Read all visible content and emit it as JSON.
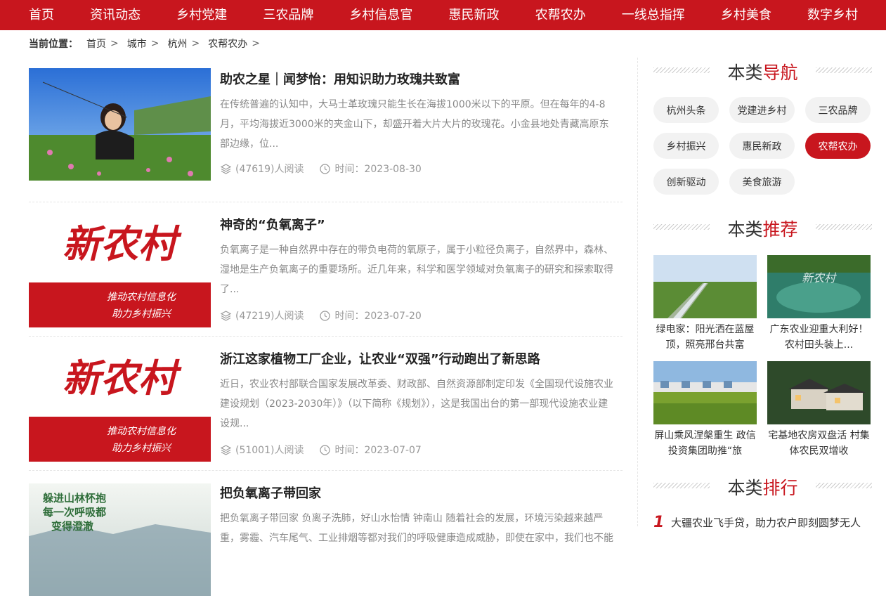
{
  "nav": [
    "首页",
    "资讯动态",
    "乡村党建",
    "三农品牌",
    "乡村信息官",
    "惠民新政",
    "农帮农办",
    "一线总指挥",
    "乡村美食",
    "数字乡村"
  ],
  "breadcrumb": {
    "label": "当前位置：",
    "items": [
      "首页",
      "城市",
      "杭州",
      "农帮农办"
    ],
    "separator": ">"
  },
  "articles": [
    {
      "title": "助农之星｜闻梦怡：用知识助力玫瑰共致富",
      "desc": "在传统普遍的认知中，大马士革玫瑰只能生长在海拔1000米以下的平原。但在每年的4-8月，平均海拔近3000米的夹金山下，却盛开着大片大片的玫瑰花。小金县地处青藏高原东部边缘，位...",
      "views": "(47619)人阅读",
      "time": "时间：2023-08-30",
      "image": "photo"
    },
    {
      "title": "神奇的“负氧离子”",
      "desc": "负氧离子是一种自然界中存在的带负电荷的氧原子，属于小粒径负离子，自然界中，森林、湿地是生产负氧离子的重要场所。近几年来，科学和医学领域对负氧离子的研究和探索取得了...",
      "views": "(47219)人阅读",
      "time": "时间：2023-07-20",
      "image": "logo"
    },
    {
      "title": "浙江这家植物工厂企业，让农业“双强”行动跑出了新思路",
      "desc": "近日，农业农村部联合国家发展改革委、财政部、自然资源部制定印发《全国现代设施农业建设规划（2023-2030年）》（以下简称《规划》），这是我国出台的第一部现代设施农业建设规...",
      "views": "(51001)人阅读",
      "time": "时间：2023-07-07",
      "image": "logo"
    },
    {
      "title": "把负氧离子带回家",
      "desc": "把负氧离子带回家 负离子洗肺，好山水怡情 钟南山 随着社会的发展，环境污染越来越严重，雾霾、汽车尾气、工业排烟等都对我们的呼吸健康造成威胁，即使在家中，我们也不能",
      "views": "",
      "time": "",
      "image": "forest"
    }
  ],
  "logo": {
    "name": "新农村",
    "line1": "推动农村信息化",
    "line2": "助力乡村振兴"
  },
  "forest_text": {
    "line1": "躲进山林怀抱",
    "line2": "每一次呼吸都",
    "line3": "变得澄澈"
  },
  "sidebar": {
    "nav_title": {
      "pre": "本类",
      "hl": "导航"
    },
    "tags": [
      "杭州头条",
      "党建进乡村",
      "三农品牌",
      "乡村振兴",
      "惠民新政",
      "农帮农办",
      "创新驱动",
      "美食旅游"
    ],
    "active_tag": "农帮农办",
    "rec_title": {
      "pre": "本类",
      "hl": "推荐"
    },
    "recs": [
      {
        "caption": "绿电家：阳光洒在蓝屋顶，照亮邢台共富",
        "image": "field"
      },
      {
        "caption": "广东农业迎重大利好！农村田头装上...",
        "image": "lake"
      },
      {
        "caption": "屏山乘风涅槃重生 政信投资集团助推“旅",
        "image": "village"
      },
      {
        "caption": "宅基地农房双盘活 村集体农民双增收",
        "image": "house"
      }
    ],
    "rank_title": {
      "pre": "本类",
      "hl": "排行"
    },
    "rank": [
      {
        "num": "1",
        "text": "大疆农业飞手贷，助力农户即刻圆梦无人"
      }
    ]
  },
  "colors": {
    "brand": "#c8161e",
    "muted": "#999999"
  },
  "icons": {
    "views": "layers-icon",
    "time": "clock-icon"
  }
}
